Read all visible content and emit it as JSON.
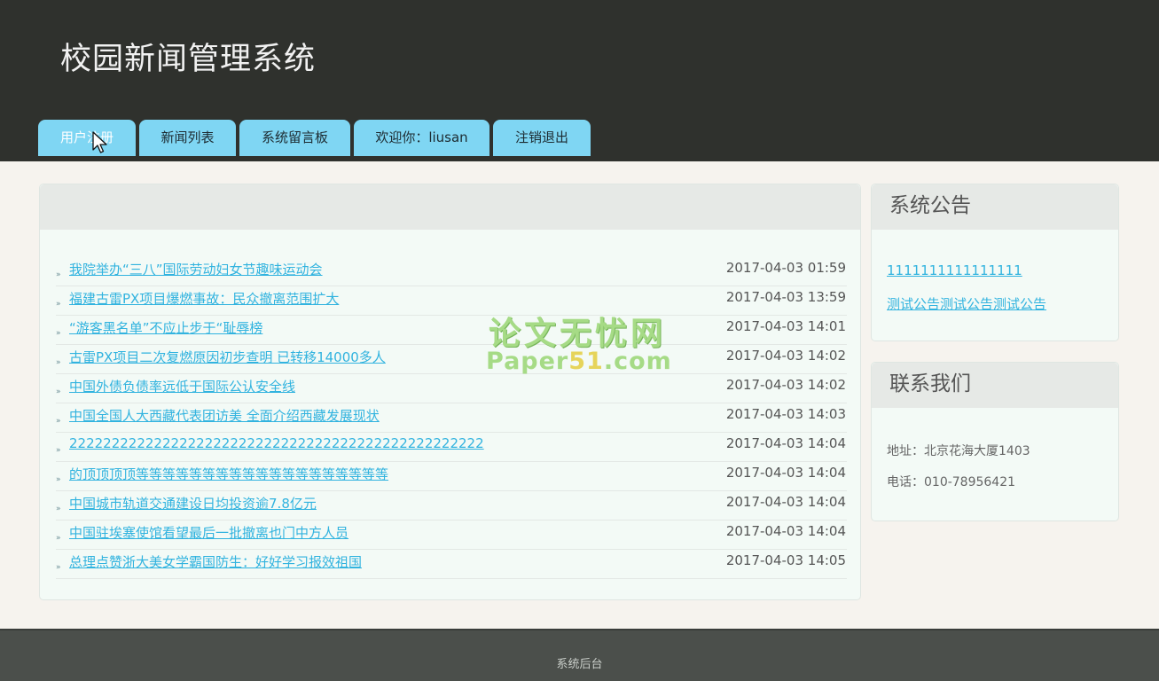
{
  "site": {
    "title": "校园新闻管理系统"
  },
  "nav": {
    "tabs": [
      {
        "label": "用户注册"
      },
      {
        "label": "新闻列表"
      },
      {
        "label": "系统留言板"
      },
      {
        "label": "欢迎你：liusan"
      },
      {
        "label": "注销退出"
      }
    ]
  },
  "news": {
    "items": [
      {
        "title": "我院举办“三八”国际劳动妇女节趣味运动会",
        "time": "2017-04-03 01:59"
      },
      {
        "title": "福建古雷PX项目爆燃事故：民众撤离范围扩大",
        "time": "2017-04-03 13:59"
      },
      {
        "title": "“游客黑名单”不应止步于“耻辱榜",
        "time": "2017-04-03 14:01"
      },
      {
        "title": "古雷PX项目二次复燃原因初步查明 已转移14000多人",
        "time": "2017-04-03 14:02"
      },
      {
        "title": "中国外债负债率远低于国际公认安全线",
        "time": "2017-04-03 14:02"
      },
      {
        "title": "中国全国人大西藏代表团访美 全面介绍西藏发展现状",
        "time": "2017-04-03 14:03"
      },
      {
        "title": "2222222222222222222222222222222222222222222222222",
        "time": "2017-04-03 14:04"
      },
      {
        "title": "的顶顶顶顶等等等等等等等等等等等等等等等等等等等",
        "time": "2017-04-03 14:04"
      },
      {
        "title": "中国城市轨道交通建设日均投资逾7.8亿元",
        "time": "2017-04-03 14:04"
      },
      {
        "title": "中国驻埃塞使馆看望最后一批撤离也门中方人员",
        "time": "2017-04-03 14:04"
      },
      {
        "title": "总理点赞浙大美女学霸国防生：好好学习报效祖国",
        "time": "2017-04-03 14:05"
      }
    ]
  },
  "notice": {
    "title": "系统公告",
    "items": [
      {
        "label": "1111111111111111"
      },
      {
        "label": "测试公告测试公告测试公告"
      }
    ]
  },
  "contact": {
    "title": "联系我们",
    "address": "地址：北京花海大厦1403",
    "phone": "电话：010-78956421"
  },
  "watermark": {
    "line1": "论文无忧网",
    "line2_a": "Paper",
    "line2_b": "51",
    "line2_c": ".com"
  },
  "footer": {
    "text": "系统后台"
  }
}
